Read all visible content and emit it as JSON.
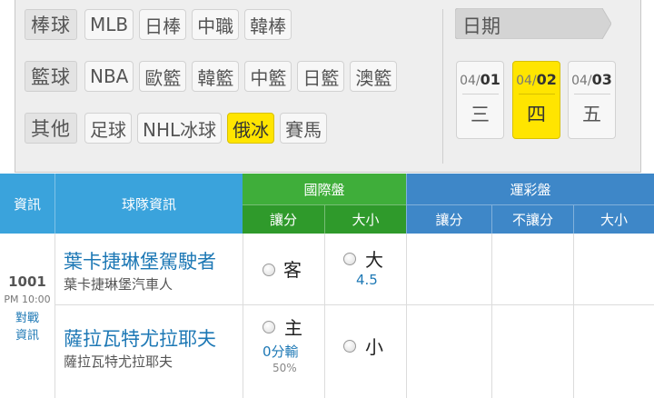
{
  "filters": {
    "baseball": {
      "label": "棒球",
      "items": [
        "MLB",
        "日棒",
        "中職",
        "韓棒"
      ]
    },
    "basketball": {
      "label": "籃球",
      "items": [
        "NBA",
        "歐籃",
        "韓籃",
        "中籃",
        "日籃",
        "澳籃"
      ]
    },
    "other": {
      "label": "其他",
      "items": [
        "足球",
        "NHL冰球",
        "俄冰",
        "賽馬"
      ],
      "active": "俄冰"
    }
  },
  "dates": {
    "header": "日期",
    "items": [
      {
        "month": "04/",
        "day": "01",
        "weekday": "三"
      },
      {
        "month": "04/",
        "day": "02",
        "weekday": "四",
        "active": true
      },
      {
        "month": "04/",
        "day": "03",
        "weekday": "五"
      }
    ]
  },
  "table": {
    "headers": {
      "info": "資訊",
      "team": "球隊資訊",
      "intl": "國際盤",
      "lottery": "運彩盤",
      "intl_spread": "讓分",
      "intl_total": "大小",
      "lot_spread": "讓分",
      "lot_nospread": "不讓分",
      "lot_total": "大小"
    },
    "game": {
      "number": "1001",
      "time": "PM 10:00",
      "matchup_link": [
        "對戰",
        "資訊"
      ],
      "away": {
        "name": "葉卡捷琳堡駕駛者",
        "sub": "葉卡捷琳堡汽車人",
        "spread_label": "客",
        "total_label": "大",
        "total_value": "4.5"
      },
      "home": {
        "name": "薩拉瓦特尤拉耶夫",
        "sub": "薩拉瓦特尤拉耶夫",
        "spread_label": "主",
        "spread_value": "0分輸",
        "spread_pct": "50%",
        "total_label": "小"
      }
    }
  },
  "colors": {
    "active": "#ffe500",
    "header_blue": "#3aa3dc",
    "header_green": "#3fae3a",
    "team_link": "#1d78b5"
  }
}
